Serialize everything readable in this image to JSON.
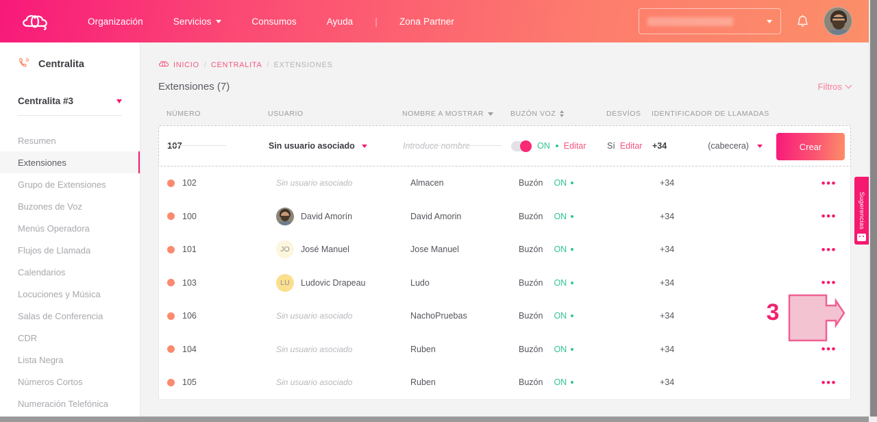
{
  "topbar": {
    "logo_icon": "cloud-logo-icon",
    "nav": [
      {
        "label": "Organización",
        "has_caret": false
      },
      {
        "label": "Servicios",
        "has_caret": true
      },
      {
        "label": "Consumos",
        "has_caret": false
      },
      {
        "label": "Ayuda",
        "has_caret": false
      },
      {
        "label": "Zona Partner",
        "has_caret": false
      }
    ],
    "separator": "|",
    "org_select_value": "",
    "bell_icon": "notification-bell-icon",
    "avatar_icon": "user-avatar"
  },
  "sidebar": {
    "header_label": "Centralita",
    "header_icon": "phone-waves-icon",
    "pbx_selected": "Centralita #3",
    "items": [
      {
        "label": "Resumen",
        "active": false
      },
      {
        "label": "Extensiones",
        "active": true
      },
      {
        "label": "Grupo de Extensiones",
        "active": false
      },
      {
        "label": "Buzones de Voz",
        "active": false
      },
      {
        "label": "Menús Operadora",
        "active": false
      },
      {
        "label": "Flujos de Llamada",
        "active": false
      },
      {
        "label": "Calendarios",
        "active": false
      },
      {
        "label": "Locuciones y Música",
        "active": false
      },
      {
        "label": "Salas de Conferencia",
        "active": false
      },
      {
        "label": "CDR",
        "active": false
      },
      {
        "label": "Lista Negra",
        "active": false
      },
      {
        "label": "Números Cortos",
        "active": false
      },
      {
        "label": "Numeración Telefónica",
        "active": false
      }
    ]
  },
  "breadcrumb": {
    "home_icon": "cloud-home-icon",
    "items": [
      "INICIO",
      "CENTRALITA",
      "EXTENSIONES"
    ],
    "separator": "/"
  },
  "page": {
    "title": "Extensiones (7)",
    "filters_label": "Filtros"
  },
  "table": {
    "headers": [
      {
        "label": "NÚMERO",
        "sort": "none"
      },
      {
        "label": "USUARIO",
        "sort": "none"
      },
      {
        "label": "NOMBRE A MOSTRAR",
        "sort": "desc"
      },
      {
        "label": "BUZÓN VOZ",
        "sort": "both"
      },
      {
        "label": "DESVÍOS",
        "sort": "none"
      },
      {
        "label": "IDENTIFICADOR DE LLAMADAS",
        "sort": "none"
      }
    ],
    "create_row": {
      "number": "107",
      "user_value": "Sin usuario asociado",
      "name_placeholder": "Introduce nombre",
      "voicemail_toggle": "on",
      "voicemail_state": "ON",
      "voicemail_edit": "Editar",
      "forward_value": "Sí",
      "forward_edit": "Editar",
      "caller_id_prefix": "+34",
      "caller_id_value": "(cabecera)",
      "create_button": "Crear"
    },
    "rows": [
      {
        "number": "102",
        "user": "Sin usuario asociado",
        "user_type": "none",
        "initials": "",
        "display_name": "Almacen",
        "voicemail_label": "Buzón",
        "voicemail_state": "ON",
        "caller_id": "+34",
        "menu": "•••"
      },
      {
        "number": "100",
        "user": "David Amorín",
        "user_type": "photo",
        "initials": "",
        "display_name": "David Amorin",
        "voicemail_label": "Buzón",
        "voicemail_state": "ON",
        "caller_id": "+34",
        "menu": "•••"
      },
      {
        "number": "101",
        "user": "José Manuel",
        "user_type": "initials",
        "initials": "JO",
        "display_name": "Jose Manuel",
        "voicemail_label": "Buzón",
        "voicemail_state": "ON",
        "caller_id": "+34",
        "menu": "•••"
      },
      {
        "number": "103",
        "user": "Ludovic Drapeau",
        "user_type": "initials",
        "initials": "LU",
        "display_name": "Ludo",
        "voicemail_label": "Buzón",
        "voicemail_state": "ON",
        "caller_id": "+34",
        "menu": "•••"
      },
      {
        "number": "106",
        "user": "Sin usuario asociado",
        "user_type": "none",
        "initials": "",
        "display_name": "NachoPruebas",
        "voicemail_label": "Buzón",
        "voicemail_state": "ON",
        "caller_id": "+34",
        "menu": "•••"
      },
      {
        "number": "104",
        "user": "Sin usuario asociado",
        "user_type": "none",
        "initials": "",
        "display_name": "Ruben",
        "voicemail_label": "Buzón",
        "voicemail_state": "ON",
        "caller_id": "+34",
        "menu": "•••"
      },
      {
        "number": "105",
        "user": "Sin usuario asociado",
        "user_type": "none",
        "initials": "",
        "display_name": "Ruben",
        "voicemail_label": "Buzón",
        "voicemail_state": "ON",
        "caller_id": "+34",
        "menu": "•••"
      }
    ]
  },
  "annotation": {
    "step_number": "3",
    "shape": "right-arrow-callout"
  },
  "suggestions_tab": {
    "label": "Sugerencias",
    "icon": "feedback-face-icon"
  },
  "colors": {
    "brand_pink": "#f5196f",
    "brand_salmon": "#fd8f68",
    "status_green": "#32c48d",
    "status_dot": "#fb8a6e",
    "link_pink": "#f5547f",
    "annotation_fill": "#f3c3d2",
    "annotation_border": "#ef5f93"
  }
}
